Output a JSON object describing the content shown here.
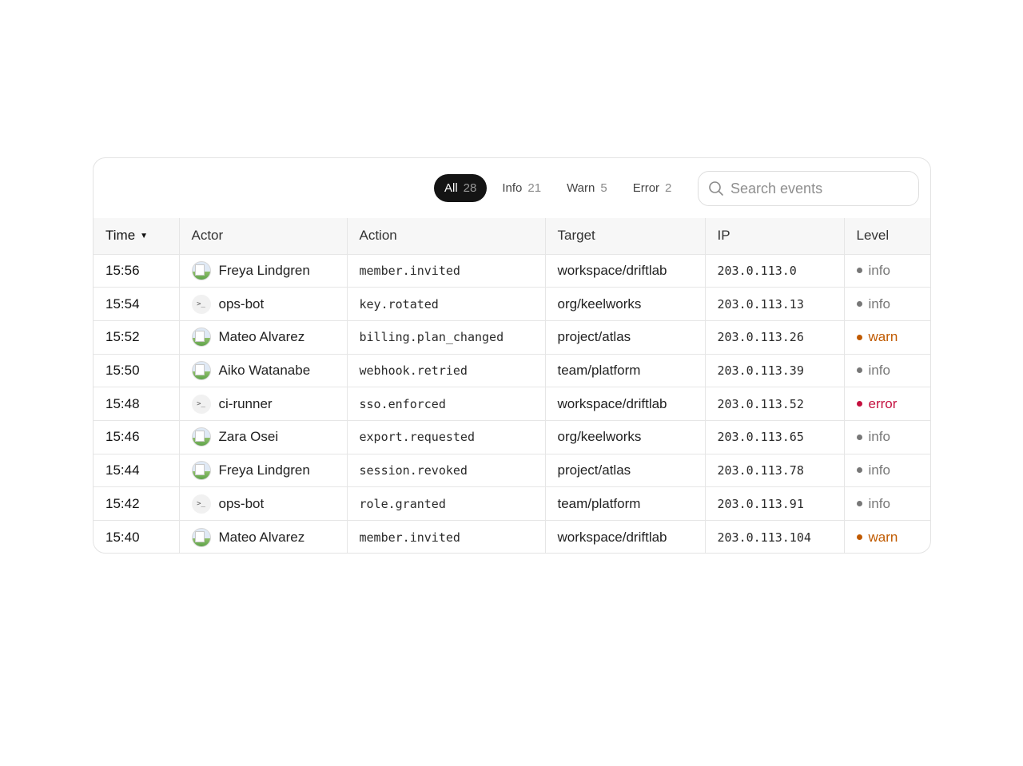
{
  "filters": [
    {
      "label": "All",
      "count": "28",
      "active": true
    },
    {
      "label": "Info",
      "count": "21",
      "active": false
    },
    {
      "label": "Warn",
      "count": "5",
      "active": false
    },
    {
      "label": "Error",
      "count": "2",
      "active": false
    }
  ],
  "search": {
    "placeholder": "Search events",
    "icon": "search-icon"
  },
  "columns": {
    "time": "Time",
    "actor": "Actor",
    "action": "Action",
    "target": "Target",
    "ip": "IP",
    "level": "Level"
  },
  "sort": {
    "column": "Time",
    "direction": "descending",
    "icon": "caret-down-icon"
  },
  "level_colors": {
    "info": "#777777",
    "warn": "#c05a00",
    "error": "#c4103f"
  },
  "rows": [
    {
      "time": "15:56",
      "actor": "Freya Lindgren",
      "actor_type": "user",
      "action": "member.invited",
      "target": "workspace/driftlab",
      "ip": "203.0.113.0",
      "level": "info"
    },
    {
      "time": "15:54",
      "actor": "ops-bot",
      "actor_type": "bot",
      "action": "key.rotated",
      "target": "org/keelworks",
      "ip": "203.0.113.13",
      "level": "info"
    },
    {
      "time": "15:52",
      "actor": "Mateo Alvarez",
      "actor_type": "user",
      "action": "billing.plan_changed",
      "target": "project/atlas",
      "ip": "203.0.113.26",
      "level": "warn"
    },
    {
      "time": "15:50",
      "actor": "Aiko Watanabe",
      "actor_type": "user",
      "action": "webhook.retried",
      "target": "team/platform",
      "ip": "203.0.113.39",
      "level": "info"
    },
    {
      "time": "15:48",
      "actor": "ci-runner",
      "actor_type": "bot",
      "action": "sso.enforced",
      "target": "workspace/driftlab",
      "ip": "203.0.113.52",
      "level": "error"
    },
    {
      "time": "15:46",
      "actor": "Zara Osei",
      "actor_type": "user",
      "action": "export.requested",
      "target": "org/keelworks",
      "ip": "203.0.113.65",
      "level": "info"
    },
    {
      "time": "15:44",
      "actor": "Freya Lindgren",
      "actor_type": "user",
      "action": "session.revoked",
      "target": "project/atlas",
      "ip": "203.0.113.78",
      "level": "info"
    },
    {
      "time": "15:42",
      "actor": "ops-bot",
      "actor_type": "bot",
      "action": "role.granted",
      "target": "team/platform",
      "ip": "203.0.113.91",
      "level": "info"
    },
    {
      "time": "15:40",
      "actor": "Mateo Alvarez",
      "actor_type": "user",
      "action": "member.invited",
      "target": "workspace/driftlab",
      "ip": "203.0.113.104",
      "level": "warn"
    }
  ],
  "bot_glyph": ">_"
}
